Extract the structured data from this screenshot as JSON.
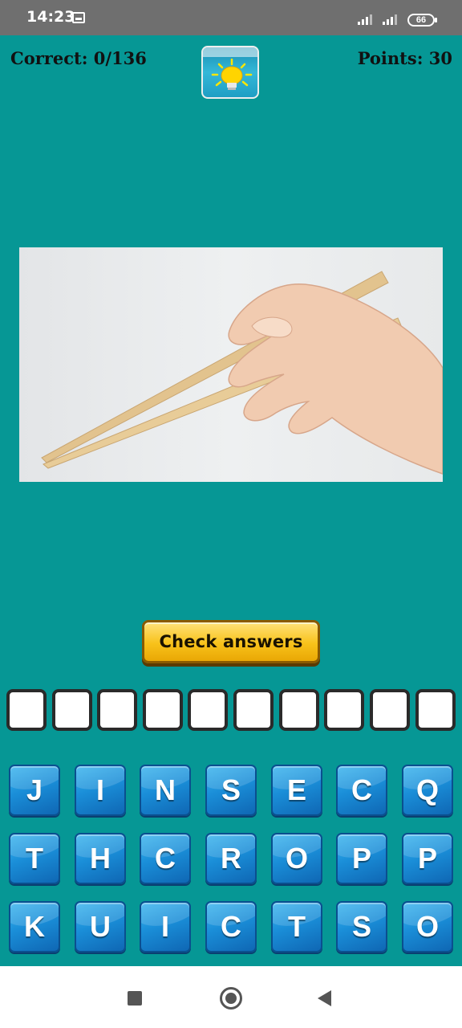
{
  "status_bar": {
    "time": "14:23",
    "battery": "66"
  },
  "header": {
    "correct_label": "Correct: 0/136",
    "points_label": "Points: 30",
    "hint_icon": "lightbulb-icon"
  },
  "picture": {
    "icon": "hand-chopsticks-photo"
  },
  "check_button": {
    "label": "Check answers"
  },
  "answer_slots": [
    "",
    "",
    "",
    "",
    "",
    "",
    "",
    "",
    "",
    ""
  ],
  "keyboard": {
    "rows": [
      [
        "J",
        "I",
        "N",
        "S",
        "E",
        "C",
        "Q"
      ],
      [
        "T",
        "H",
        "C",
        "R",
        "O",
        "P",
        "P"
      ],
      [
        "K",
        "U",
        "I",
        "C",
        "T",
        "S",
        "O"
      ]
    ]
  },
  "colors": {
    "background": "#069795",
    "key_blue": "#1a8ed8",
    "button_yellow": "#f8c21a"
  }
}
